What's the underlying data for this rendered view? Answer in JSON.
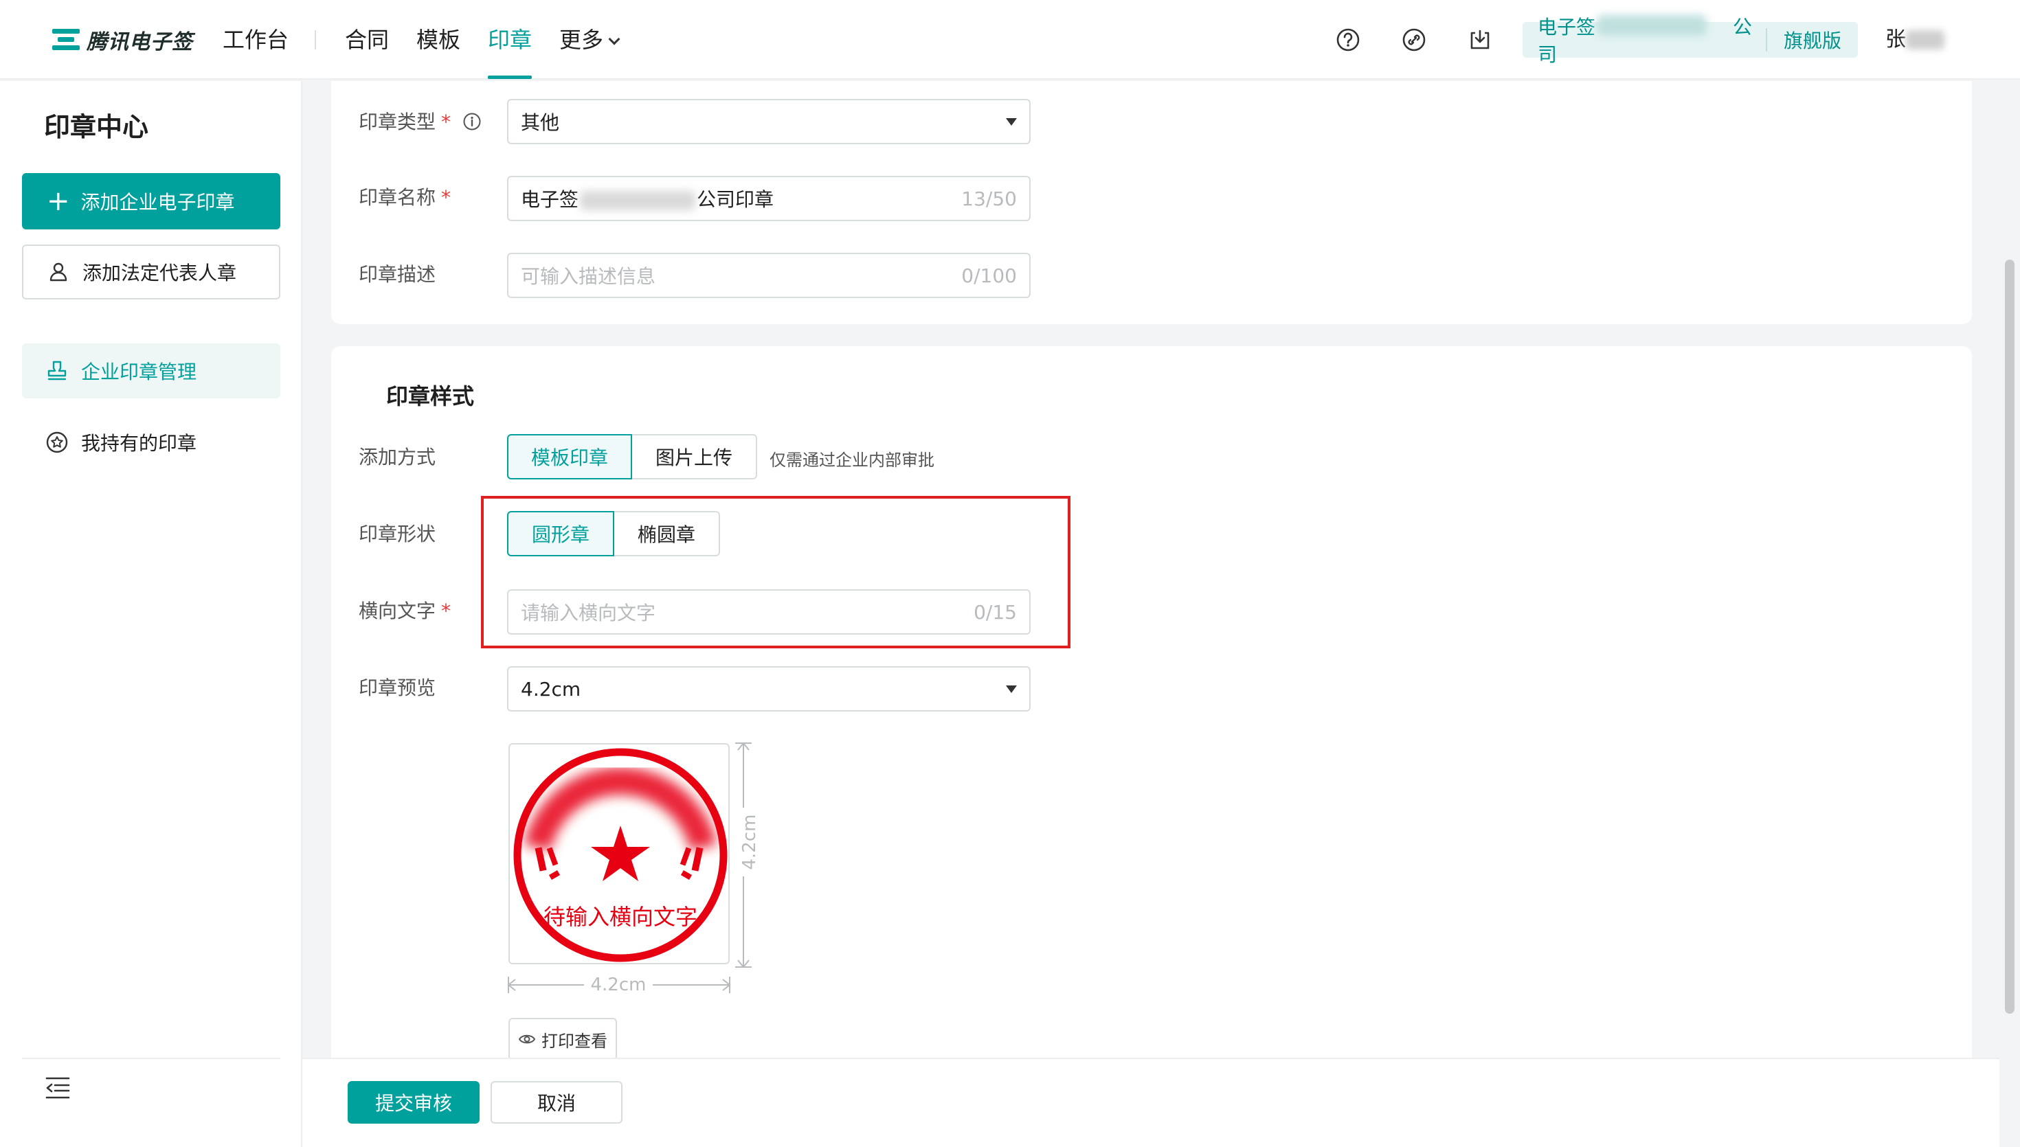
{
  "brand": {
    "name": "腾讯电子签",
    "accent": "#00a19c"
  },
  "nav": {
    "workbench": "工作台",
    "items": [
      "合同",
      "模板",
      "印章",
      "更多"
    ],
    "active": "印章"
  },
  "header": {
    "icons": [
      "help-icon",
      "link-icon",
      "download-icon"
    ],
    "company_prefix": "电子签",
    "company_suffix": "公司",
    "edition": "旗舰版",
    "user_initial": "张"
  },
  "sidebar": {
    "title": "印章中心",
    "add_enterprise_seal": "添加企业电子印章",
    "add_legal_seal": "添加法定代表人章",
    "items": [
      {
        "label": "企业印章管理",
        "icon": "stamp-icon",
        "active": true
      },
      {
        "label": "我持有的印章",
        "icon": "seal-star-icon",
        "active": false
      }
    ]
  },
  "form": {
    "seal_type": {
      "label": "印章类型",
      "value": "其他"
    },
    "seal_name": {
      "label": "印章名称",
      "prefix": "电子签",
      "suffix": "公司印章",
      "count": "13/50"
    },
    "seal_desc": {
      "label": "印章描述",
      "placeholder": "可输入描述信息",
      "count": "0/100"
    }
  },
  "style_section": {
    "title": "印章样式",
    "add_method": {
      "label": "添加方式",
      "options": [
        "模板印章",
        "图片上传"
      ],
      "selected": "模板印章",
      "hint": "仅需通过企业内部审批"
    },
    "shape": {
      "label": "印章形状",
      "options": [
        "圆形章",
        "椭圆章"
      ],
      "selected": "圆形章"
    },
    "horizontal_text": {
      "label": "横向文字",
      "placeholder": "请输入横向文字",
      "count": "0/15"
    },
    "preview": {
      "label": "印章预览",
      "size": "4.2cm",
      "stamp_text": "待输入横向文字",
      "width_label": "4.2cm",
      "height_label": "4.2cm",
      "stamp_color": "#e60012"
    },
    "print_button": "打印查看"
  },
  "actions": {
    "submit": "提交审核",
    "cancel": "取消"
  }
}
